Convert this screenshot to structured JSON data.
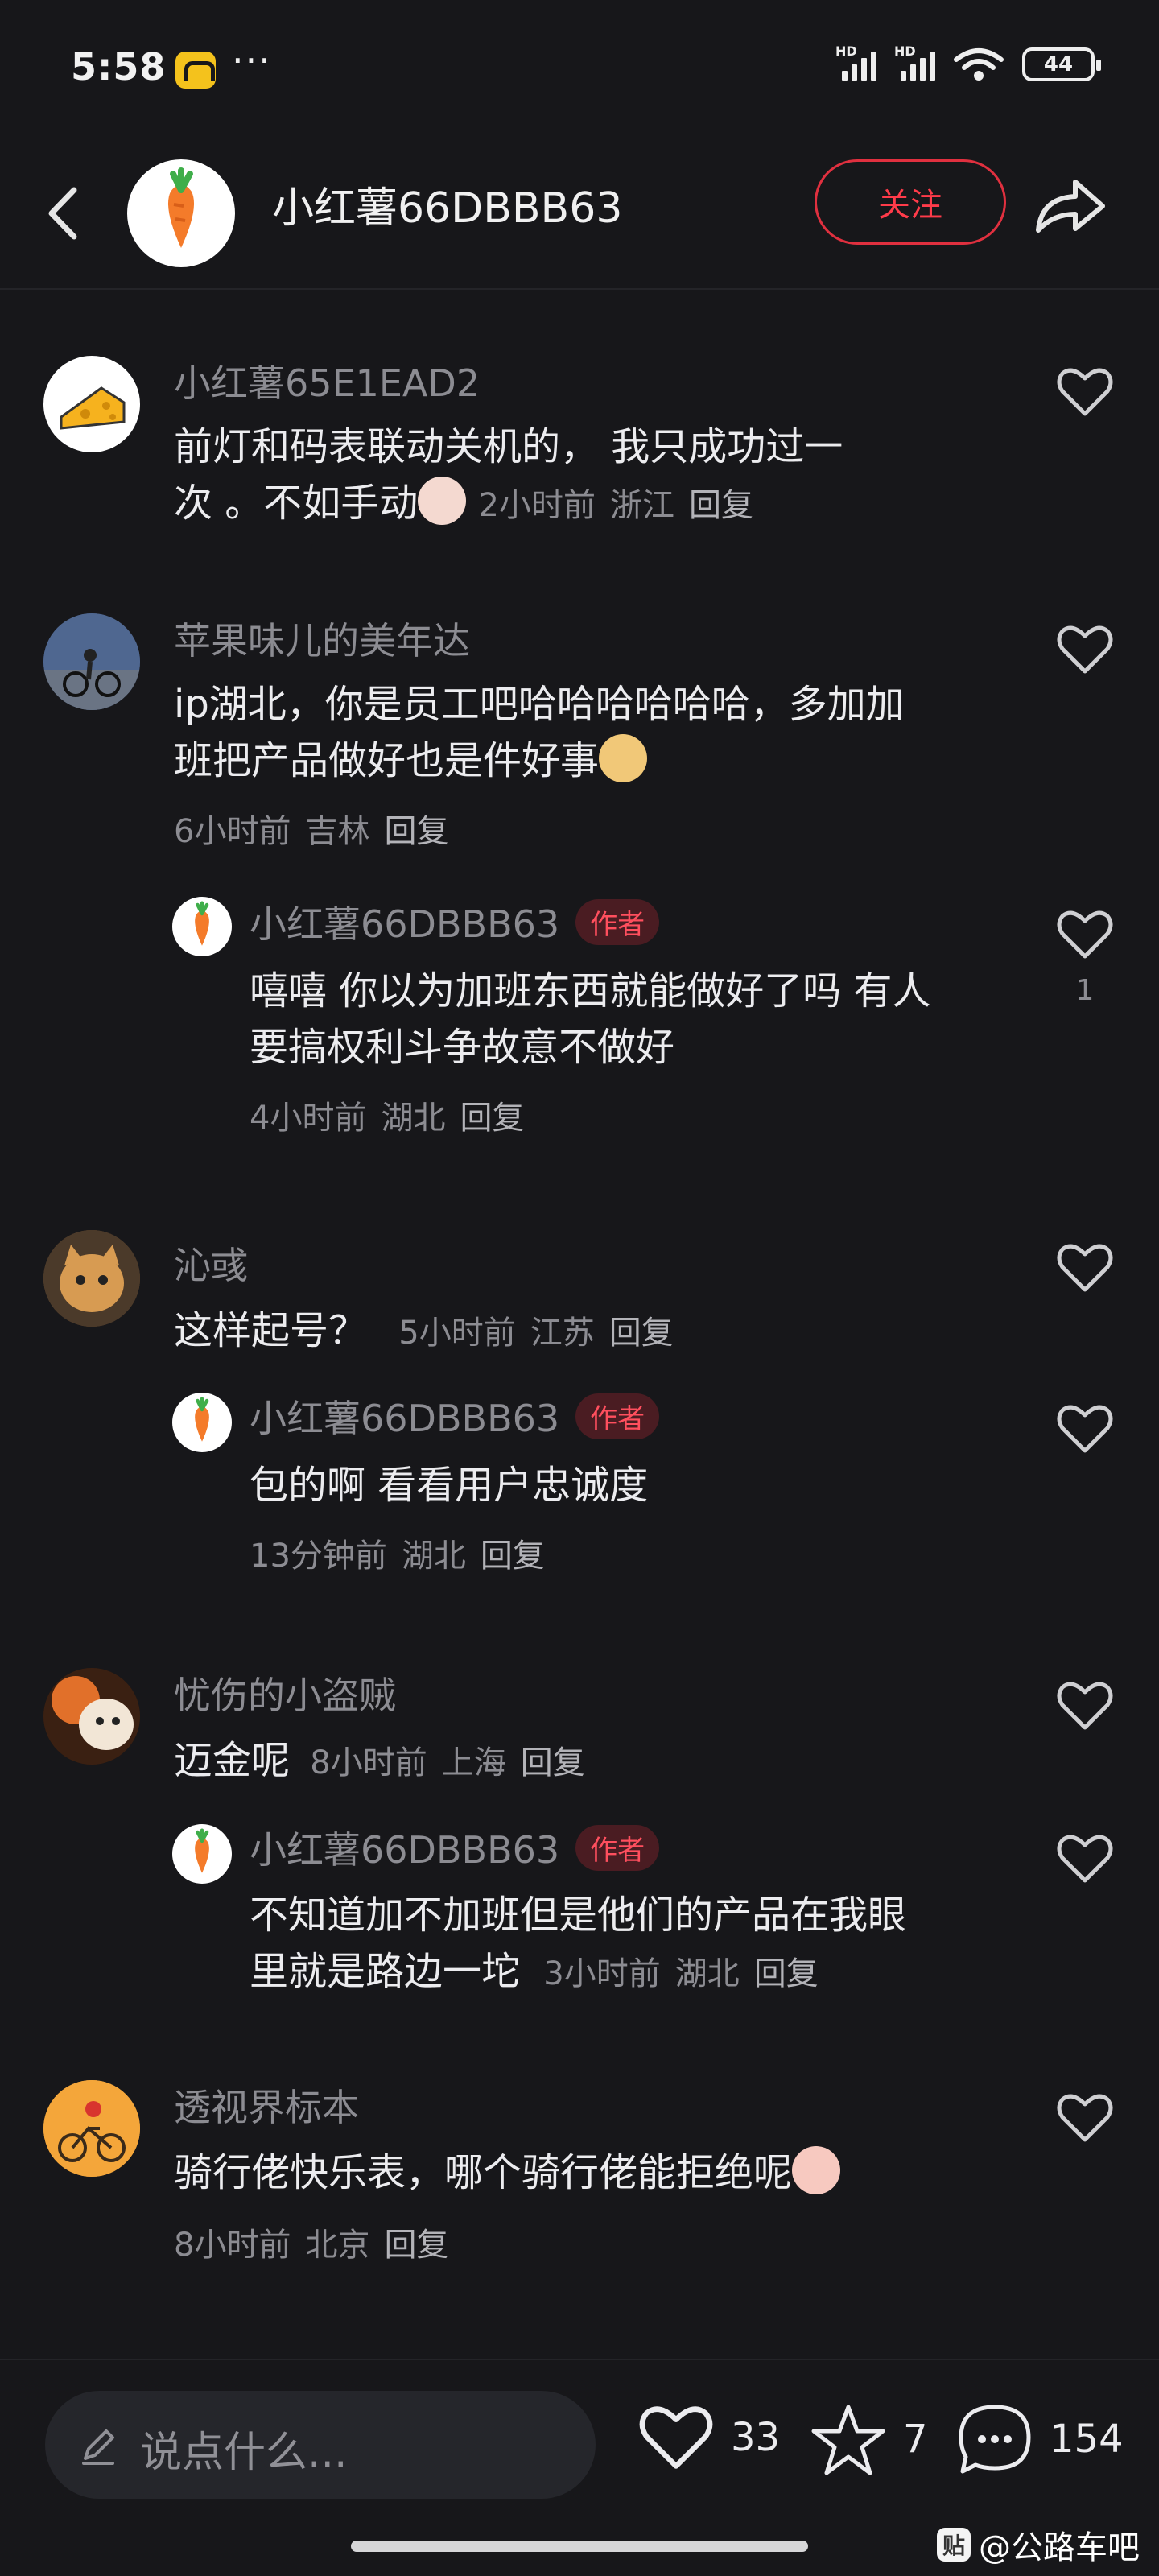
{
  "status_bar": {
    "time": "5:58",
    "dots": "···",
    "battery": "44",
    "signal_label": "HD"
  },
  "header": {
    "username": "小红薯66DBBB63",
    "follow_label": "关注"
  },
  "comments": [
    {
      "username": "小红薯65E1EAD2",
      "text_line1": "前灯和码表联动关机的， 我只成功过一",
      "text_line2": "次 。不如手动",
      "time": "2小时前",
      "location": "浙江",
      "reply_label": "回复"
    },
    {
      "username": "苹果味儿的美年达",
      "text_line1": "ip湖北，你是员工吧哈哈哈哈哈哈，多加加",
      "text_line2": "班把产品做好也是件好事",
      "time": "6小时前",
      "location": "吉林",
      "reply_label": "回复",
      "reply": {
        "username": "小红薯66DBBB63",
        "badge": "作者",
        "text_line1": "嘻嘻 你以为加班东西就能做好了吗 有人",
        "text_line2": "要搞权利斗争故意不做好",
        "time": "4小时前",
        "location": "湖北",
        "reply_label": "回复",
        "likes": "1"
      }
    },
    {
      "username": "沁彧",
      "text_line1": "这样起号？",
      "time": "5小时前",
      "location": "江苏",
      "reply_label": "回复",
      "reply": {
        "username": "小红薯66DBBB63",
        "badge": "作者",
        "text_line1": "包的啊 看看用户忠诚度",
        "time": "13分钟前",
        "location": "湖北",
        "reply_label": "回复"
      }
    },
    {
      "username": "忧伤的小盗贼",
      "text_line1": "迈金呢",
      "time": "8小时前",
      "location": "上海",
      "reply_label": "回复",
      "reply": {
        "username": "小红薯66DBBB63",
        "badge": "作者",
        "text_line1": "不知道加不加班但是他们的产品在我眼",
        "text_line2": "里就是路边一坨",
        "time": "3小时前",
        "location": "湖北",
        "reply_label": "回复"
      }
    },
    {
      "username": "透视界标本",
      "text_line1": "骑行佬快乐表，哪个骑行佬能拒绝呢",
      "time": "8小时前",
      "location": "北京",
      "reply_label": "回复"
    }
  ],
  "bottom_bar": {
    "input_placeholder": "说点什么...",
    "likes": "33",
    "favorites": "7",
    "comments": "154"
  },
  "watermark": {
    "badge": "贴",
    "text": "@公路车吧"
  },
  "colors": {
    "background": "#17171a",
    "accent_red": "#ff3b4a",
    "muted_text": "#8c8c92"
  },
  "icons": [
    "back-arrow-icon",
    "carrot-avatar",
    "share-icon",
    "heart-icon",
    "star-icon",
    "comment-icon",
    "pen-icon"
  ]
}
